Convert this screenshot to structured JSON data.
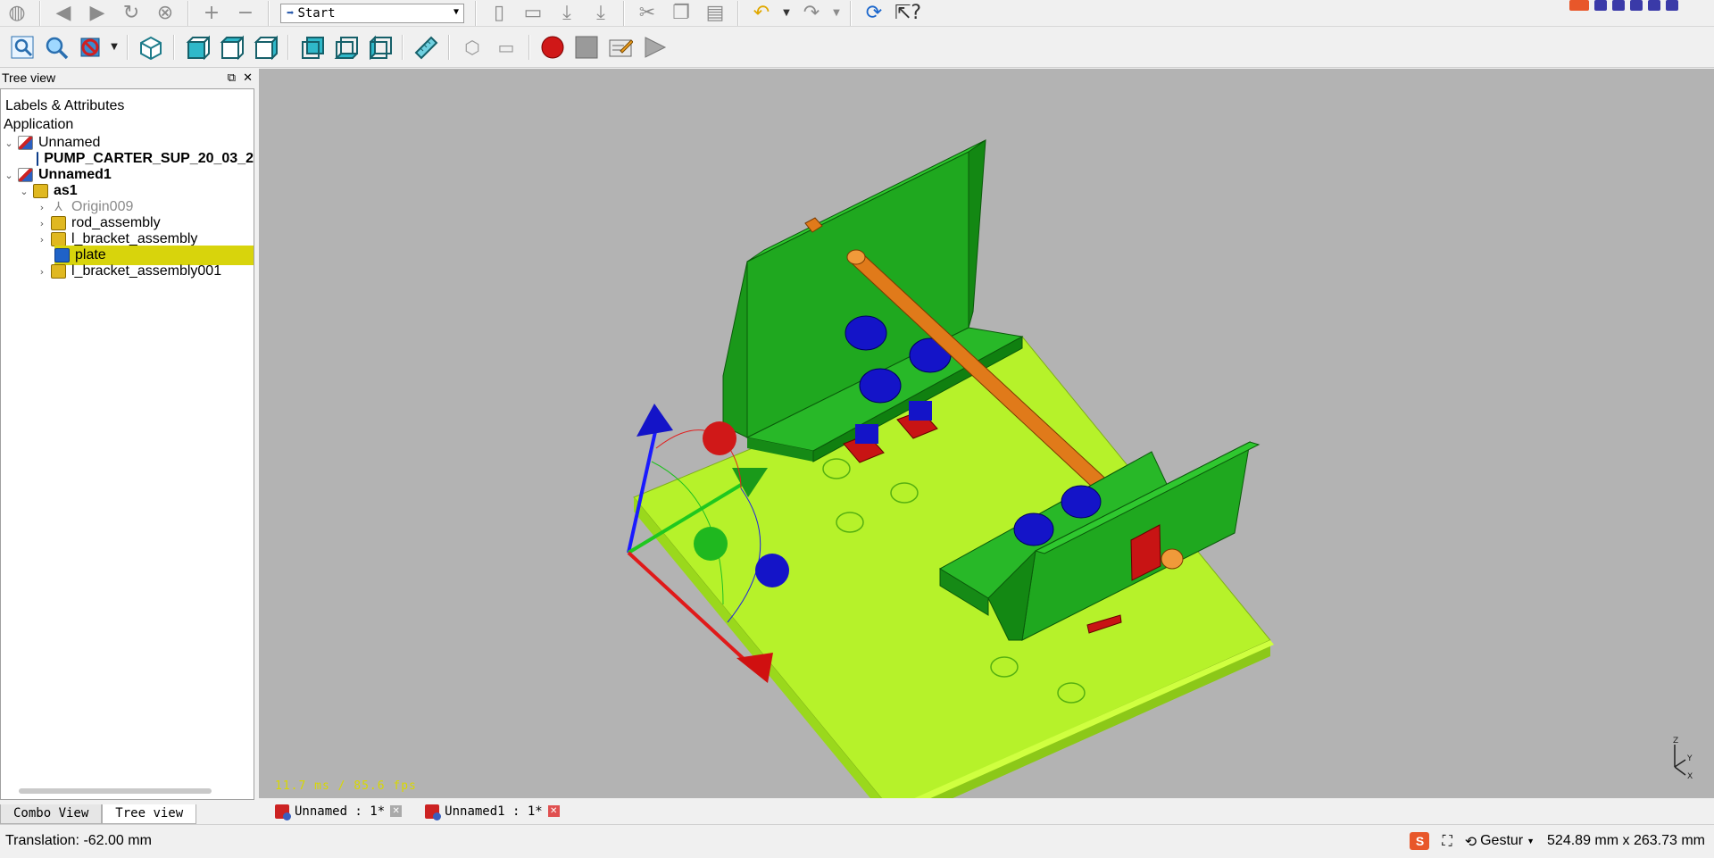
{
  "toolbar1": {
    "workbench_value": "Start",
    "buttons": [
      "web-icon",
      "back-icon",
      "forward-icon",
      "refresh-icon",
      "stop-icon",
      "zoom-in-icon",
      "zoom-out-icon",
      "new-icon",
      "open-icon",
      "save-icon",
      "save-as-icon",
      "cut-icon",
      "copy-icon",
      "paste-icon",
      "undo-icon",
      "redo-icon",
      "recompute-icon",
      "whats-this-icon"
    ]
  },
  "toolbar2": {
    "buttons": [
      "fit-all-icon",
      "fit-selection-icon",
      "draw-style-icon",
      "isometric-view-icon",
      "front-view-icon",
      "top-view-icon",
      "right-view-icon",
      "rear-view-icon",
      "bottom-view-icon",
      "left-view-icon",
      "measure-icon",
      "part-icon",
      "group-icon",
      "record-macro-icon",
      "stop-macro-icon",
      "edit-macro-icon",
      "execute-macro-icon"
    ]
  },
  "tree_panel": {
    "title": "Tree view",
    "labels_header": "Labels & Attributes",
    "application_label": "Application",
    "items": [
      {
        "label": "Unnamed",
        "bold": false
      },
      {
        "label": "PUMP_CARTER_SUP_20_03_2",
        "bold": true
      },
      {
        "label": "Unnamed1",
        "bold": true
      },
      {
        "label": "as1",
        "bold": true
      },
      {
        "label": "Origin009",
        "bold": false
      },
      {
        "label": "rod_assembly",
        "bold": false
      },
      {
        "label": "l_bracket_assembly",
        "bold": false
      },
      {
        "label": "plate",
        "bold": false
      },
      {
        "label": "l_bracket_assembly001",
        "bold": false
      }
    ]
  },
  "panel_tabs": [
    "Combo View",
    "Tree view"
  ],
  "viewport": {
    "fps_text": "11.7 ms / 85.6 fps",
    "axis_labels": [
      "Z",
      "Y",
      "X"
    ]
  },
  "doc_tabs": [
    "Unnamed : 1*",
    "Unnamed1 : 1*"
  ],
  "status": {
    "message": "Translation: -62.00 mm",
    "nav_style": "Gestur",
    "dimensions": "524.89 mm x 263.73 mm"
  },
  "colors": {
    "viewport_bg": "#b3b3b3",
    "plate": "#b6f22a",
    "bracket": "#1fa81f",
    "rod": "#e07a1a",
    "bolt": "#1414c8",
    "nut": "#c81414",
    "selection": "#d8d40c"
  }
}
